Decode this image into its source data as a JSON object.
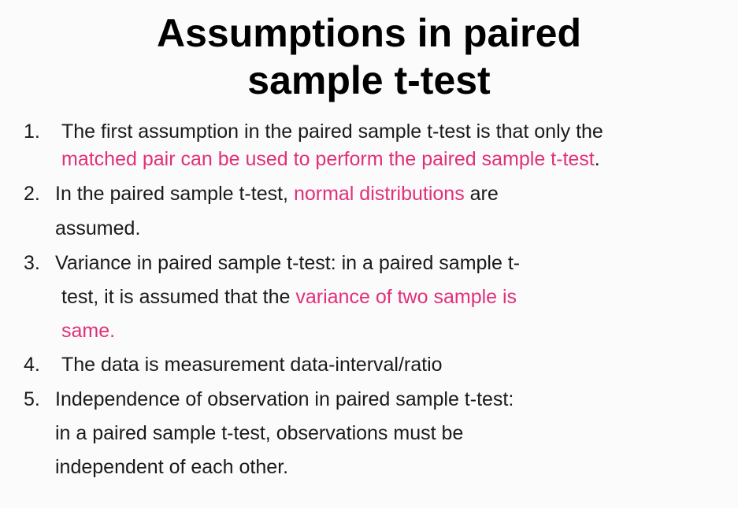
{
  "slide": {
    "title_line1": "Assumptions in paired",
    "title_line2": "sample t-test",
    "items": [
      {
        "number": "1.",
        "line1_text": "The first assumption in the paired sample t-test is that only the",
        "line2_highlight": "matched pair can be used to perform the paired sample t-test",
        "line2_tail": "."
      },
      {
        "number": "2.",
        "line1_text": "In the paired sample t-test, ",
        "line1_highlight": "normal distributions",
        "line1_tail": " are",
        "line2_text": "assumed."
      },
      {
        "number": "3.",
        "line1_text": "Variance in paired sample t-test: in a paired sample t-",
        "line2_text": "test, it is assumed that the ",
        "line2_highlight": "variance of two sample is",
        "line3_highlight": "same."
      },
      {
        "number": "4.",
        "line1_text": "The data is measurement data-interval/ratio"
      },
      {
        "number": "5.",
        "line1_text": "Independence of observation in paired sample t-test:",
        "line2_text": "in a paired sample t-test, observations must be",
        "line3_text": "independent of each other."
      }
    ]
  },
  "colors": {
    "highlight": "#e0307a",
    "text": "#1a1a1a",
    "background": "#fbfbfb"
  }
}
